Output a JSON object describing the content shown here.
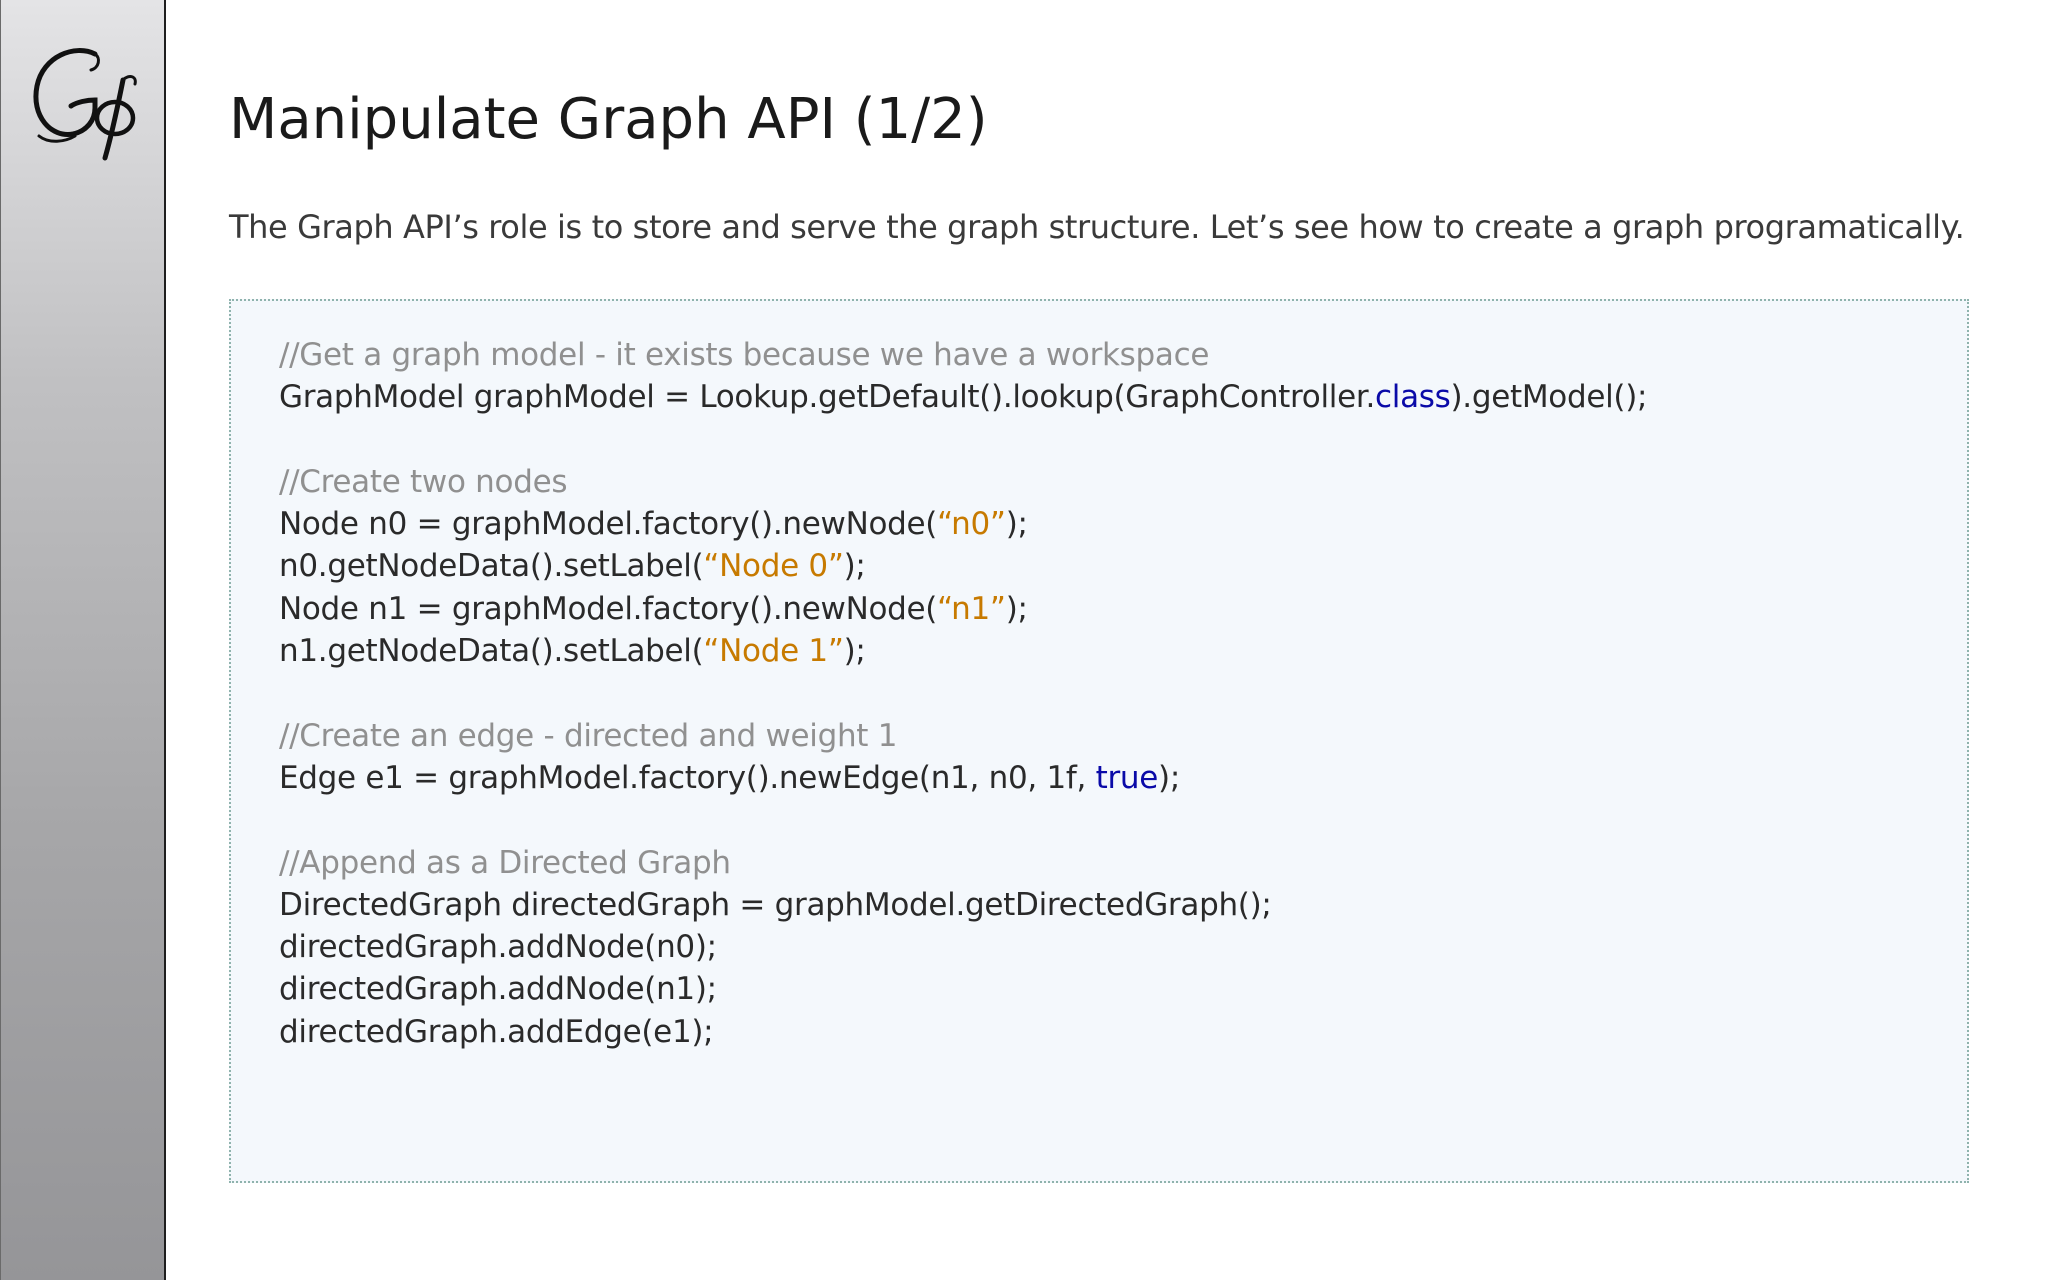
{
  "slide": {
    "title": "Manipulate Graph API (1/2)",
    "subtitle": "The Graph API’s role is to store and serve the graph structure. Let’s see how to create a graph programatically.",
    "logo": "gephi-logo"
  },
  "colors": {
    "comment": "#909090",
    "keyword": "#0a0aa8",
    "string": "#c77a00",
    "code_background": "#f4f8fc",
    "code_border": "#8fb3ad"
  },
  "code": [
    [
      {
        "t": "comment",
        "v": "//Get a graph model - it exists because we have a workspace"
      }
    ],
    [
      {
        "t": "plain",
        "v": "GraphModel graphModel = Lookup.getDefault().lookup(GraphController."
      },
      {
        "t": "keyword",
        "v": "class"
      },
      {
        "t": "plain",
        "v": ").getModel();"
      }
    ],
    [],
    [
      {
        "t": "comment",
        "v": "//Create two nodes"
      }
    ],
    [
      {
        "t": "plain",
        "v": "Node n0 = graphModel.factory().newNode("
      },
      {
        "t": "string",
        "v": "“n0”"
      },
      {
        "t": "plain",
        "v": ");"
      }
    ],
    [
      {
        "t": "plain",
        "v": "n0.getNodeData().setLabel("
      },
      {
        "t": "string",
        "v": "“Node 0”"
      },
      {
        "t": "plain",
        "v": ");"
      }
    ],
    [
      {
        "t": "plain",
        "v": "Node n1 = graphModel.factory().newNode("
      },
      {
        "t": "string",
        "v": "“n1”"
      },
      {
        "t": "plain",
        "v": ");"
      }
    ],
    [
      {
        "t": "plain",
        "v": "n1.getNodeData().setLabel("
      },
      {
        "t": "string",
        "v": "“Node 1”"
      },
      {
        "t": "plain",
        "v": ");"
      }
    ],
    [],
    [
      {
        "t": "comment",
        "v": "//Create an edge - directed and weight 1"
      }
    ],
    [
      {
        "t": "plain",
        "v": "Edge e1 = graphModel.factory().newEdge(n1, n0, 1f, "
      },
      {
        "t": "keyword",
        "v": "true"
      },
      {
        "t": "plain",
        "v": ");"
      }
    ],
    [],
    [
      {
        "t": "comment",
        "v": "//Append as a Directed Graph"
      }
    ],
    [
      {
        "t": "plain",
        "v": "DirectedGraph directedGraph = graphModel.getDirectedGraph();"
      }
    ],
    [
      {
        "t": "plain",
        "v": "directedGraph.addNode(n0);"
      }
    ],
    [
      {
        "t": "plain",
        "v": "directedGraph.addNode(n1);"
      }
    ],
    [
      {
        "t": "plain",
        "v": "directedGraph.addEdge(e1);"
      }
    ]
  ]
}
